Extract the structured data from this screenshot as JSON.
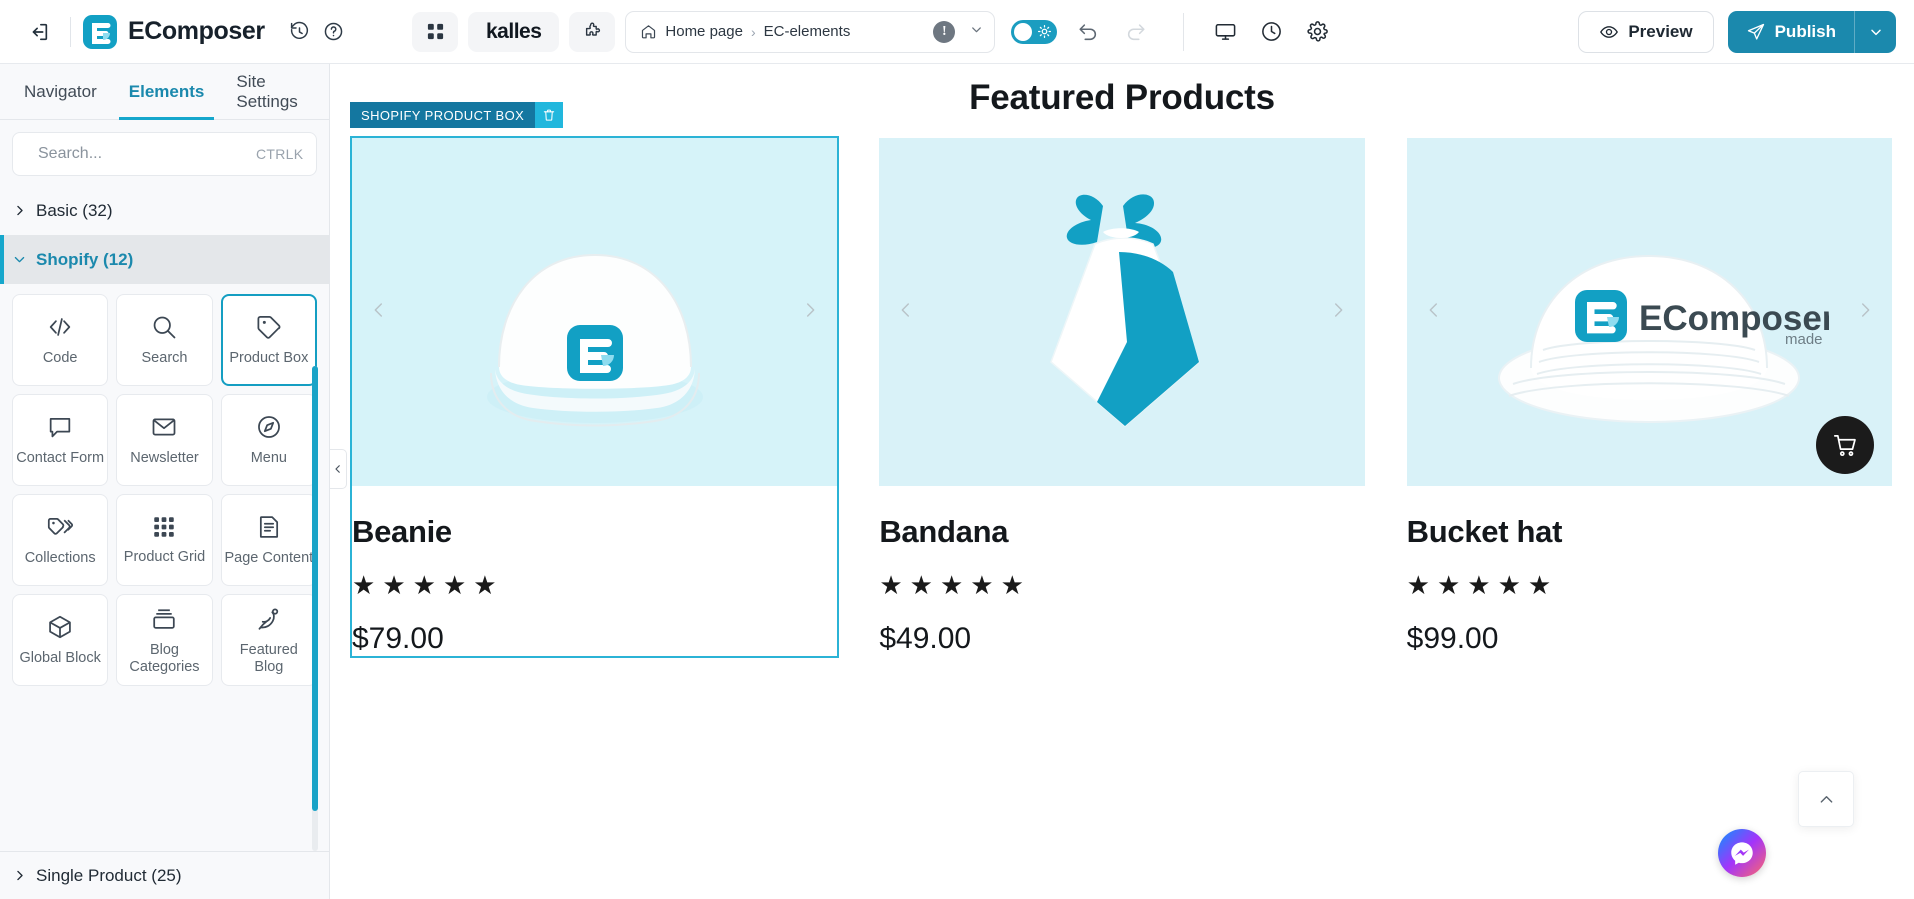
{
  "topbar": {
    "back_icon": "exit-arrow-icon",
    "brand_name": "EComposer",
    "history_icon": "history-icon",
    "help_icon": "help-circle-icon",
    "apps_icon": "grid-apps-icon",
    "theme_name": "kalles",
    "extension_icon": "puzzle-piece-icon",
    "breadcrumb": {
      "home_label": "Home page",
      "separator": "›",
      "page_label": "EC-elements",
      "status_icon": "warning-circle-icon",
      "status_glyph": "!",
      "caret_icon": "chevron-down-icon"
    },
    "light_toggle": {
      "name": "light-mode-toggle",
      "state": "on",
      "icon": "sun-icon"
    },
    "undo_icon": "undo-icon",
    "redo_icon": "redo-icon",
    "desktop_icon": "desktop-monitor-icon",
    "clock_icon": "clock-icon",
    "settings_icon": "gear-icon",
    "preview_label": "Preview",
    "preview_icon": "eye-icon",
    "publish_label": "Publish",
    "publish_icon": "paper-plane-icon",
    "publish_caret_icon": "chevron-down-icon",
    "accent_color": "#1b89ad"
  },
  "sidebar": {
    "tabs": [
      {
        "label": "Navigator",
        "active": false
      },
      {
        "label": "Elements",
        "active": true
      },
      {
        "label": "Site Settings",
        "active": false
      }
    ],
    "search": {
      "placeholder": "Search...",
      "value": "",
      "shortcut": "CTRLK",
      "icon": "search-icon"
    },
    "groups": [
      {
        "label": "Basic (32)",
        "open": false,
        "chevron": "chevron-right-icon"
      },
      {
        "label": "Shopify (12)",
        "open": true,
        "chevron": "chevron-down-icon"
      },
      {
        "label": "Single Product (25)",
        "open": false,
        "chevron": "chevron-right-icon"
      }
    ],
    "tiles": [
      {
        "label": "Code",
        "icon": "code-brackets-icon",
        "selected": false
      },
      {
        "label": "Search",
        "icon": "search-icon",
        "selected": false
      },
      {
        "label": "Product Box",
        "icon": "price-tag-icon",
        "selected": true
      },
      {
        "label": "Contact Form",
        "icon": "speech-bubble-icon",
        "selected": false
      },
      {
        "label": "Newsletter",
        "icon": "envelope-icon",
        "selected": false
      },
      {
        "label": "Menu",
        "icon": "compass-menu-icon",
        "selected": false
      },
      {
        "label": "Collections",
        "icon": "tags-stack-icon",
        "selected": false
      },
      {
        "label": "Product Grid",
        "icon": "grid-dots-icon",
        "selected": false
      },
      {
        "label": "Page Content",
        "icon": "document-lines-icon",
        "selected": false
      },
      {
        "label": "Global Block",
        "icon": "cube-icon",
        "selected": false
      },
      {
        "label": "Blog Categories",
        "icon": "stacked-cards-icon",
        "selected": false
      },
      {
        "label": "Featured Blog",
        "icon": "blog-pen-icon",
        "selected": false
      }
    ],
    "collapse_icon": "chevron-left-icon"
  },
  "canvas": {
    "section_title": "Featured Products",
    "selected_badge": {
      "label": "SHOPIFY PRODUCT BOX",
      "delete_icon": "trash-icon"
    },
    "products": [
      {
        "name": "Beanie",
        "price": "$79.00",
        "rating": 5,
        "image_alt": "white-beanie-hat",
        "selected": true,
        "prev_icon": "chevron-left-icon",
        "next_icon": "chevron-right-icon"
      },
      {
        "name": "Bandana",
        "price": "$49.00",
        "rating": 5,
        "image_alt": "teal-white-bandana",
        "selected": false,
        "prev_icon": "chevron-left-icon",
        "next_icon": "chevron-right-icon"
      },
      {
        "name": "Bucket hat",
        "price": "$99.00",
        "rating": 5,
        "image_alt": "white-bucket-hat",
        "selected": false,
        "prev_icon": "chevron-left-icon",
        "next_icon": "chevron-right-icon",
        "cart_icon": "shopping-cart-icon"
      }
    ],
    "star_glyph": "★",
    "scroll_top_icon": "chevron-up-icon",
    "messenger_icon": "messenger-icon"
  }
}
